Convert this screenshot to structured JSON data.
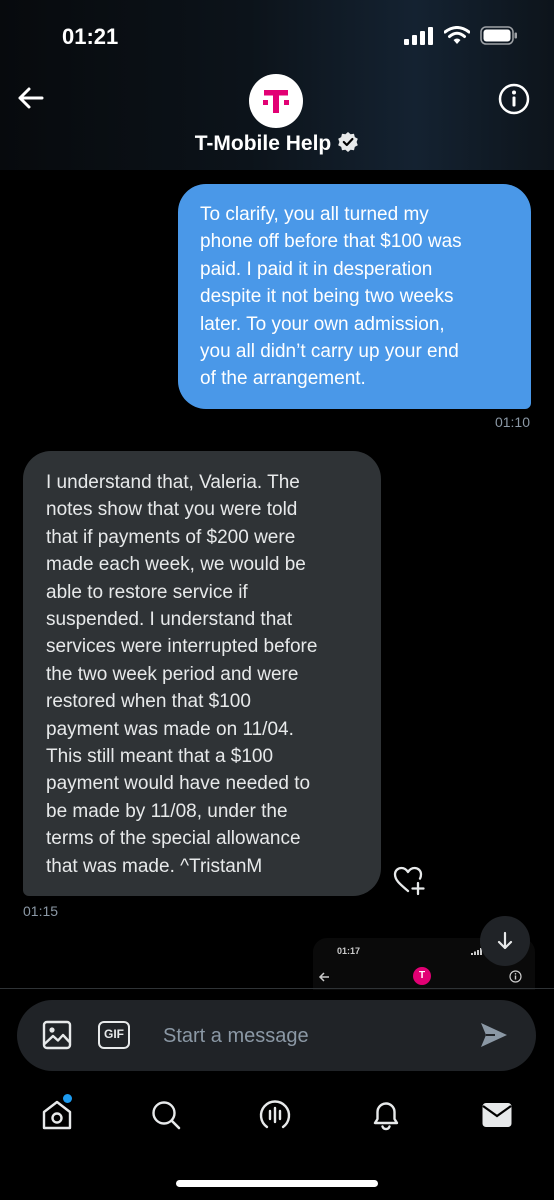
{
  "status_bar": {
    "time": "01:21"
  },
  "header": {
    "contact_name": "T-Mobile Help",
    "avatar_letter": "T",
    "brand_color": "#e20074"
  },
  "messages": [
    {
      "direction": "outgoing",
      "lines": [
        "To clarify, you all turned my",
        "phone off before that $100 was",
        "paid. I paid it in desperation",
        "despite it not being two weeks",
        "later. To your own admission,",
        "you all didn’t carry up your end",
        "of the arrangement."
      ],
      "time": "01:10"
    },
    {
      "direction": "incoming",
      "lines": [
        "I understand that, Valeria. The",
        "notes show that you were told",
        "that if payments of $200 were",
        "made each week, we would be",
        "able to restore service if",
        "suspended. I understand that",
        "services were interrupted before",
        "the two week period and were",
        "restored when that $100",
        "payment was made on 11/04.",
        "This still meant that a $100",
        "payment would have needed to",
        "be made by 11/08, under the",
        "terms of the special allowance",
        "that was made. ^TristanM"
      ],
      "time": "01:15"
    }
  ],
  "embedded_preview": {
    "time": "01:17",
    "logo_letter": "T"
  },
  "composer": {
    "placeholder": "Start a message",
    "gif_label": "GIF"
  },
  "icons": {
    "back": "arrow-left-icon",
    "info": "info-icon",
    "verified": "verified-badge-icon",
    "like": "heart-plus-icon",
    "scroll_down": "arrow-down-icon",
    "media": "image-icon",
    "send": "send-icon",
    "home": "home-icon",
    "search": "search-icon",
    "spaces": "spaces-icon",
    "notifications": "bell-icon",
    "messages": "envelope-icon"
  },
  "colors": {
    "background": "#000000",
    "outgoing_bubble": "#4a98e8",
    "incoming_bubble": "#2f3336",
    "accent": "#1d9bf0",
    "muted_text": "#8b98a5"
  }
}
